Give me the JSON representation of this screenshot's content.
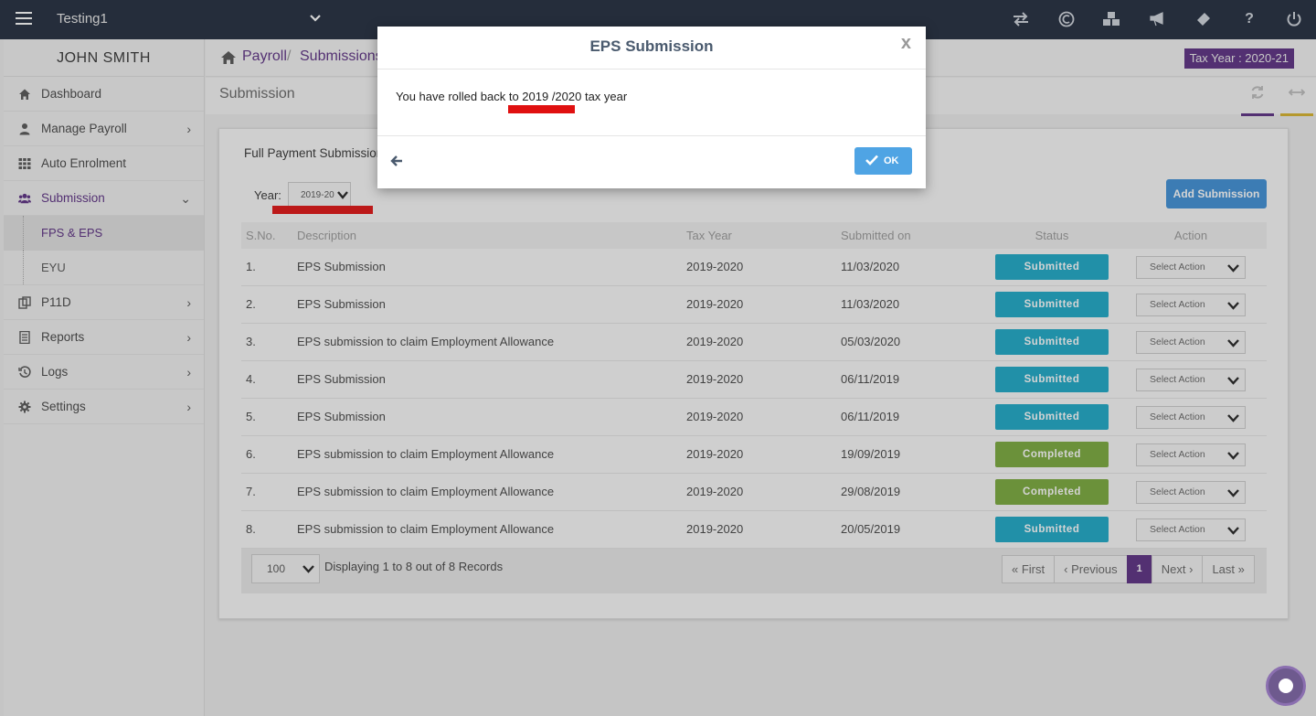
{
  "topbar": {
    "company": "Testing1",
    "icons": [
      "menu-icon",
      "chevron-down-icon",
      "exchange-icon",
      "currency-icon",
      "cubes-icon",
      "bullhorn-icon",
      "ticket-icon",
      "help-icon",
      "power-icon"
    ],
    "help_glyph": "?"
  },
  "sidebar": {
    "user": "JOHN SMITH",
    "items": [
      {
        "label": "Dashboard",
        "icon": "home-icon"
      },
      {
        "label": "Manage Payroll",
        "icon": "user-icon"
      },
      {
        "label": "Auto Enrolment",
        "icon": "grid-icon"
      },
      {
        "label": "Submission",
        "icon": "users-icon"
      },
      {
        "label": "P11D",
        "icon": "copy-icon"
      },
      {
        "label": "Reports",
        "icon": "list-icon"
      },
      {
        "label": "Logs",
        "icon": "history-icon"
      },
      {
        "label": "Settings",
        "icon": "gear-icon"
      }
    ],
    "sub_items": [
      {
        "label": "FPS & EPS"
      },
      {
        "label": "EYU"
      }
    ]
  },
  "breadcrumb": {
    "items": [
      "Payroll",
      "Submissions"
    ],
    "separator": "/"
  },
  "tax_year_badge": "Tax Year : 2020-21",
  "page": {
    "title": "Submission"
  },
  "panel": {
    "title": "Full Payment Submission",
    "year_label": "Year:",
    "year_value": "2019-20",
    "add_button": "Add Submission"
  },
  "table": {
    "headers": [
      "S.No.",
      "Description",
      "Tax Year",
      "Submitted on",
      "Status",
      "Action"
    ],
    "rows": [
      {
        "sno": "1.",
        "desc": "EPS Submission",
        "tax": "2019-2020",
        "date": "11/03/2020",
        "status": "Submitted",
        "action": "Select Action"
      },
      {
        "sno": "2.",
        "desc": "EPS Submission",
        "tax": "2019-2020",
        "date": "11/03/2020",
        "status": "Submitted",
        "action": "Select Action"
      },
      {
        "sno": "3.",
        "desc": "EPS submission to claim Employment Allowance",
        "tax": "2019-2020",
        "date": "05/03/2020",
        "status": "Submitted",
        "action": "Select Action"
      },
      {
        "sno": "4.",
        "desc": "EPS Submission",
        "tax": "2019-2020",
        "date": "06/11/2019",
        "status": "Submitted",
        "action": "Select Action"
      },
      {
        "sno": "5.",
        "desc": "EPS Submission",
        "tax": "2019-2020",
        "date": "06/11/2019",
        "status": "Submitted",
        "action": "Select Action"
      },
      {
        "sno": "6.",
        "desc": "EPS submission to claim Employment Allowance",
        "tax": "2019-2020",
        "date": "19/09/2019",
        "status": "Completed",
        "action": "Select Action"
      },
      {
        "sno": "7.",
        "desc": "EPS submission to claim Employment Allowance",
        "tax": "2019-2020",
        "date": "29/08/2019",
        "status": "Completed",
        "action": "Select Action"
      },
      {
        "sno": "8.",
        "desc": "EPS submission to claim Employment Allowance",
        "tax": "2019-2020",
        "date": "20/05/2019",
        "status": "Submitted",
        "action": "Select Action"
      }
    ]
  },
  "pager": {
    "per_page": "100",
    "info": "Displaying 1 to 8 out of 8 Records",
    "first": "« First",
    "previous": "‹ Previous",
    "current": "1",
    "next": "Next ›",
    "last": "Last »"
  },
  "modal": {
    "title": "EPS Submission",
    "close": "x",
    "message": "You have rolled back to 2019 /2020 tax year",
    "ok": "OK"
  },
  "colors": {
    "topbar": "#1f2a3c",
    "accent": "#5a2d82",
    "submitted": "#1aa8c7",
    "completed": "#79a93a",
    "annotation": "#e01010",
    "ok_button": "#4fa4e4",
    "add_button": "#3d8fd6"
  }
}
